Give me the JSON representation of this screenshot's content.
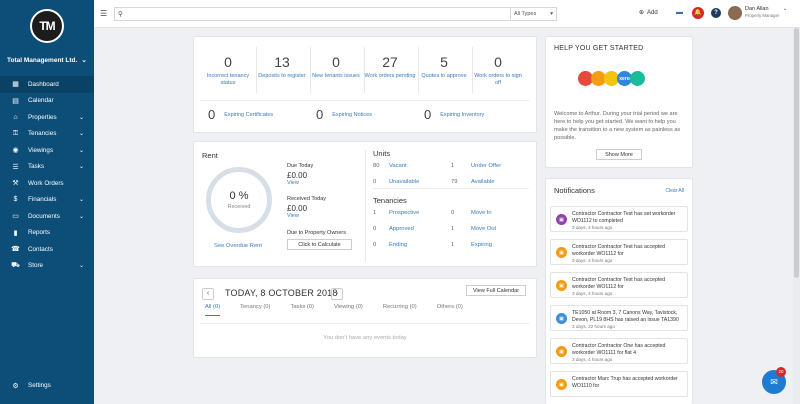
{
  "sidebar": {
    "logo_text": "TM",
    "company": "Total Management Ltd.",
    "items": [
      {
        "label": "Dashboard",
        "icon": "dashboard-icon",
        "glyph": "▦",
        "chevron": false,
        "active": true
      },
      {
        "label": "Calendar",
        "icon": "calendar-icon",
        "glyph": "▤",
        "chevron": false
      },
      {
        "label": "Properties",
        "icon": "properties-icon",
        "glyph": "⌂",
        "chevron": true
      },
      {
        "label": "Tenancies",
        "icon": "tenancies-icon",
        "glyph": "⚿",
        "chevron": true
      },
      {
        "label": "Viewings",
        "icon": "viewings-icon",
        "glyph": "◉",
        "chevron": true
      },
      {
        "label": "Tasks",
        "icon": "tasks-icon",
        "glyph": "☰",
        "chevron": true
      },
      {
        "label": "Work Orders",
        "icon": "work-orders-icon",
        "glyph": "⚒",
        "chevron": false
      },
      {
        "label": "Financials",
        "icon": "financials-icon",
        "glyph": "$",
        "chevron": true
      },
      {
        "label": "Documents",
        "icon": "documents-icon",
        "glyph": "▭",
        "chevron": true
      },
      {
        "label": "Reports",
        "icon": "reports-icon",
        "glyph": "▮",
        "chevron": false
      },
      {
        "label": "Contacts",
        "icon": "contacts-icon",
        "glyph": "☎",
        "chevron": false
      },
      {
        "label": "Store",
        "icon": "store-icon",
        "glyph": "⛟",
        "chevron": true
      }
    ],
    "settings_label": "Settings"
  },
  "topbar": {
    "search_placeholder": "",
    "types_label": "All Types",
    "add_label": "Add",
    "bell_count": "",
    "user_name": "Dan Allan",
    "user_role": "Property Manager"
  },
  "stats": [
    {
      "value": "0",
      "label": "Incorrect tenancy status"
    },
    {
      "value": "13",
      "label": "Deposits to register"
    },
    {
      "value": "0",
      "label": "New tenants issues"
    },
    {
      "value": "27",
      "label": "Work orders pending"
    },
    {
      "value": "5",
      "label": "Quotes to approve"
    },
    {
      "value": "0",
      "label": "Work orders to sign off"
    }
  ],
  "expiring": [
    {
      "value": "0",
      "label": "Expiring Certificates"
    },
    {
      "value": "0",
      "label": "Expiring Notices"
    },
    {
      "value": "0",
      "label": "Expiring Inventory"
    }
  ],
  "rent": {
    "title": "Rent",
    "percent": "0 %",
    "percent_sub": "Received",
    "overdue_link": "See Overdue Rent",
    "due_today_label": "Due Today",
    "due_today_value": "£0.00",
    "received_today_label": "Received Today",
    "received_today_value": "£0.00",
    "view": "View",
    "due_owners_label": "Due to Property Owners",
    "calc_button": "Click to Calculate"
  },
  "units": {
    "title": "Units",
    "rows": [
      {
        "n1": "80",
        "l1": "Vacant",
        "n2": "1",
        "l2": "Under Offer"
      },
      {
        "n1": "0",
        "l1": "Unavailable",
        "n2": "79",
        "l2": "Available"
      }
    ]
  },
  "tenancies": {
    "title": "Tenancies",
    "rows": [
      {
        "n1": "1",
        "l1": "Prospective",
        "n2": "0",
        "l2": "Move In"
      },
      {
        "n1": "0",
        "l1": "Approved",
        "n2": "1",
        "l2": "Move Out"
      },
      {
        "n1": "0",
        "l1": "Ending",
        "n2": "1",
        "l2": "Expiring"
      }
    ]
  },
  "calendar": {
    "title": "TODAY, 8 OCTOBER 2018",
    "full_button": "View Full Calendar",
    "tabs": [
      "All (0)",
      "Tenancy (0)",
      "Tasks (0)",
      "Viewing (0)",
      "Recurring (0)",
      "Others (0)"
    ],
    "empty": "You don't have any events today"
  },
  "help": {
    "title": "HELP YOU GET STARTED",
    "text": "Welcome to Arthur. During your trial period we are here to help you get started. We want to help you make the transition to a new system as painless as possible.",
    "button": "Show More",
    "logo_colors": [
      "#e8483b",
      "#f39c12",
      "#f1c40f",
      "#2e86de",
      "#1abc9c"
    ],
    "logo_text": [
      "",
      "",
      "",
      "xero",
      ""
    ]
  },
  "notifications": {
    "title": "Notifications",
    "clear": "Clear All",
    "items": [
      {
        "text": "Contractor Contractor Test has set workorder WO1112 to completed",
        "time": "3 days, 4 hours ago",
        "color": "#8e44ad"
      },
      {
        "text": "Contractor Contractor Test has accepted workorder WO1112 for",
        "time": "3 days, 4 hours ago",
        "color": "#f39c12"
      },
      {
        "text": "Contractor Contractor Test has accepted workorder WO1112 for",
        "time": "3 days, 4 hours ago",
        "color": "#f39c12"
      },
      {
        "text": "TE1050 at Room 3, 7 Canons Way, Tavistock, Devon, PL19 8HS has raised an issue TA1390",
        "time": "3 days, 22 hours ago",
        "color": "#3a8fd6"
      },
      {
        "text": "Contractor Contractor One has accepted workorder WO1111 for flat 4",
        "time": "3 days, 4 hours ago",
        "color": "#f39c12"
      },
      {
        "text": "Contractor Marc Trup has accepted workorder WO1110 for",
        "time": "",
        "color": "#f39c12"
      }
    ]
  },
  "chat_badge": "20"
}
